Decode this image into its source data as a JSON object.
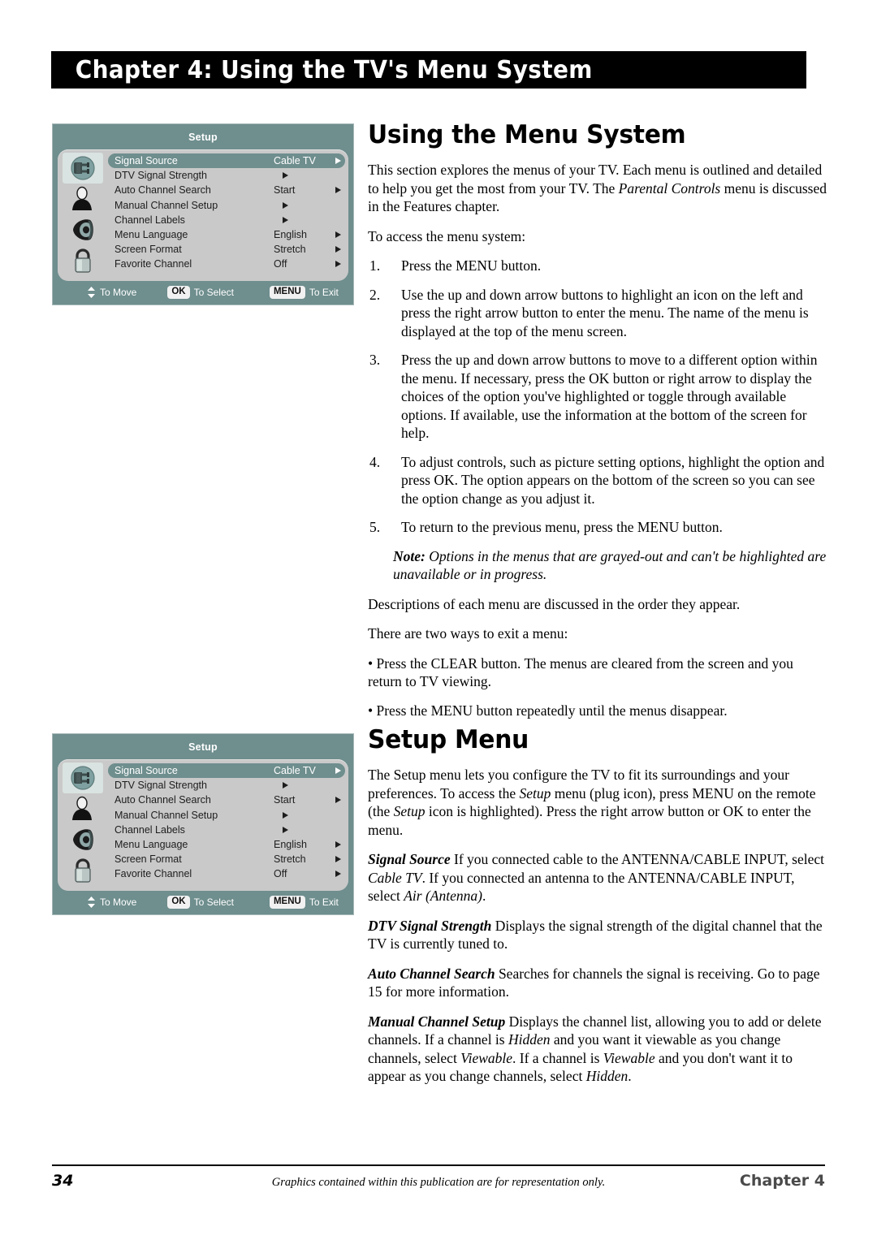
{
  "banner": {
    "title": "Chapter 4: Using the TV's Menu System"
  },
  "tv_menu": {
    "title": "Setup",
    "icons": [
      {
        "name": "plug-icon",
        "selected": true
      },
      {
        "name": "person-icon",
        "selected": false
      },
      {
        "name": "speaker-icon",
        "selected": false
      },
      {
        "name": "padlock-icon",
        "selected": false
      }
    ],
    "rows": [
      {
        "label": "Signal Source",
        "value": "Cable TV",
        "arrow": "right",
        "highlight": true
      },
      {
        "label": "DTV Signal Strength",
        "value": "",
        "arrow": "mid",
        "highlight": false
      },
      {
        "label": "Auto Channel Search",
        "value": "Start",
        "arrow": "right",
        "highlight": false
      },
      {
        "label": "Manual Channel Setup",
        "value": "",
        "arrow": "mid",
        "highlight": false
      },
      {
        "label": "Channel Labels",
        "value": "",
        "arrow": "mid",
        "highlight": false
      },
      {
        "label": "Menu Language",
        "value": "English",
        "arrow": "right",
        "highlight": false
      },
      {
        "label": "Screen Format",
        "value": "Stretch",
        "arrow": "right",
        "highlight": false
      },
      {
        "label": "Favorite Channel",
        "value": "Off",
        "arrow": "right",
        "highlight": false
      }
    ],
    "footer": {
      "move_label": "To Move",
      "ok_key": "OK",
      "select_label": "To Select",
      "menu_key": "MENU",
      "exit_label": "To Exit"
    },
    "colors": {
      "panel_teal": "#6f8e8e",
      "body_gray": "#c9c9c9",
      "selected_icon_bg": "#d9e3e1"
    }
  },
  "section1": {
    "title": "Using the Menu System",
    "intro_a": "This section explores the menus of your TV. Each menu is outlined and detailed to help you get the most from your TV. The ",
    "intro_italic": "Parental Controls",
    "intro_b": " menu is discussed in the Features chapter.",
    "access_lead": "To access the menu system:",
    "steps": [
      {
        "num": "1.",
        "text": "Press the MENU button."
      },
      {
        "num": "2.",
        "text": "Use the up and down arrow buttons to highlight an icon on the left and press the right arrow button to enter the menu. The name of the menu is displayed at the top of the menu screen."
      },
      {
        "num": "3.",
        "text": "Press the up and down arrow buttons to move to a different option within the menu. If necessary, press the OK button or right arrow to display the choices of the option you've highlighted or toggle through available options. If available, use the information at the bottom of the screen for help."
      },
      {
        "num": "4.",
        "text": "To adjust controls, such as picture setting options, highlight the option and press OK. The option appears on the bottom of the screen so you can see the option change as you adjust it."
      },
      {
        "num": "5.",
        "text": "To return to the previous menu, press the MENU button."
      }
    ],
    "note_label": "Note:",
    "note_text": " Options in the menus that are grayed-out and can't be highlighted are unavailable or in progress.",
    "descriptions_line": "Descriptions of each menu are discussed in the order they appear.",
    "exit_lead": "There are two ways to exit a menu:",
    "bullets": [
      "• Press the CLEAR button. The menus are cleared from the screen and you return to TV viewing.",
      "• Press the MENU button repeatedly until the menus disappear."
    ]
  },
  "section2": {
    "title": "Setup Menu",
    "intro_a": "The Setup menu lets you configure the TV to fit its surroundings and your preferences. To access the ",
    "intro_i1": "Setup",
    "intro_b": " menu (plug icon), press MENU on the remote (the ",
    "intro_i2": "Setup",
    "intro_c": " icon is highlighted). Press the right arrow button or OK to enter the menu.",
    "signal_source_term": "Signal Source",
    "signal_source_a": "  If you connected cable to the ANTENNA/CABLE INPUT, select ",
    "signal_source_i1": "Cable TV",
    "signal_source_b": ". If you connected an antenna to the ANTENNA/CABLE INPUT, select ",
    "signal_source_i2": "Air (Antenna)",
    "signal_source_c": ".",
    "dtv_term": "DTV Signal Strength",
    "dtv_text": "  Displays the signal strength of the digital channel that the TV is currently tuned to.",
    "auto_term": "Auto Channel Search",
    "auto_text": "  Searches for channels the signal is receiving. Go to page 15 for more information.",
    "manual_term": "Manual Channel Setup",
    "manual_a": "  Displays the channel list, allowing you to add or delete channels. If a channel is ",
    "manual_i1": "Hidden",
    "manual_b": " and you want it viewable as you change channels, select ",
    "manual_i2": "Viewable",
    "manual_c": ". If a channel is ",
    "manual_i3": "Viewable",
    "manual_d": " and you don't want it to appear as you change channels, select ",
    "manual_i4": "Hidden",
    "manual_e": "."
  },
  "footer": {
    "page_number": "34",
    "note": "Graphics contained within this publication are for representation only.",
    "chapter": "Chapter 4"
  }
}
